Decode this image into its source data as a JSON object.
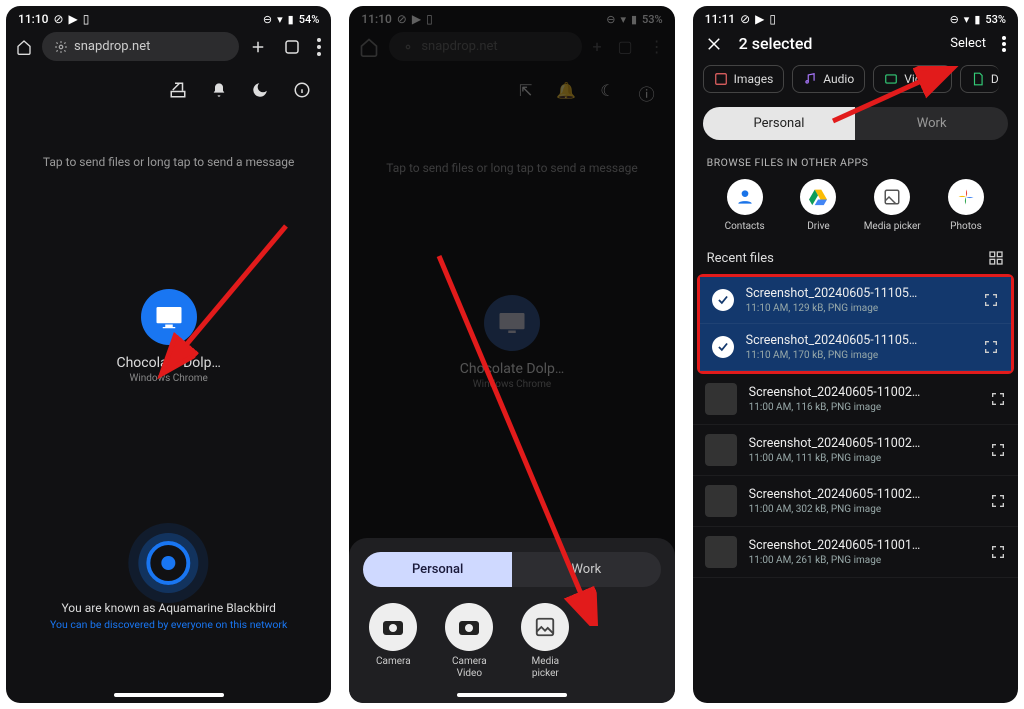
{
  "p1": {
    "time": "11:10",
    "battery": "54%",
    "url": "snapdrop.net",
    "hint": "Tap to send files or long tap to send a message",
    "peer_name": "Chocolate Dolp…",
    "peer_sub": "Windows Chrome",
    "known": "You are known as Aquamarine Blackbird",
    "known_sub": "You can be discovered by everyone on this network"
  },
  "p2": {
    "time": "11:10",
    "battery": "53%",
    "url": "snapdrop.net",
    "hint": "Tap to send files or long tap to send a message",
    "peer_name": "Chocolate Dolp…",
    "peer_sub": "Windows Chrome",
    "seg_personal": "Personal",
    "seg_work": "Work",
    "apps": [
      "Camera",
      "Camera\nVideo",
      "Media\npicker"
    ]
  },
  "p3": {
    "time": "11:11",
    "battery": "53%",
    "title": "2 selected",
    "select": "Select",
    "chips": [
      "Images",
      "Audio",
      "Videos",
      "D"
    ],
    "seg_personal": "Personal",
    "seg_work": "Work",
    "browse": "BROWSE FILES IN OTHER APPS",
    "apps": [
      "Contacts",
      "Drive",
      "Media picker",
      "Photos"
    ],
    "recent": "Recent files",
    "files": [
      {
        "name": "Screenshot_20240605-11105…",
        "sub": "11:10 AM, 129 kB, PNG image",
        "sel": true
      },
      {
        "name": "Screenshot_20240605-11105…",
        "sub": "11:10 AM, 170 kB, PNG image",
        "sel": true
      },
      {
        "name": "Screenshot_20240605-11002…",
        "sub": "11:00 AM, 116 kB, PNG image",
        "sel": false
      },
      {
        "name": "Screenshot_20240605-11002…",
        "sub": "11:00 AM, 111 kB, PNG image",
        "sel": false
      },
      {
        "name": "Screenshot_20240605-11002…",
        "sub": "11:00 AM, 302 kB, PNG image",
        "sel": false
      },
      {
        "name": "Screenshot_20240605-11001…",
        "sub": "11:00 AM, 261 kB, PNG image",
        "sel": false
      }
    ]
  }
}
